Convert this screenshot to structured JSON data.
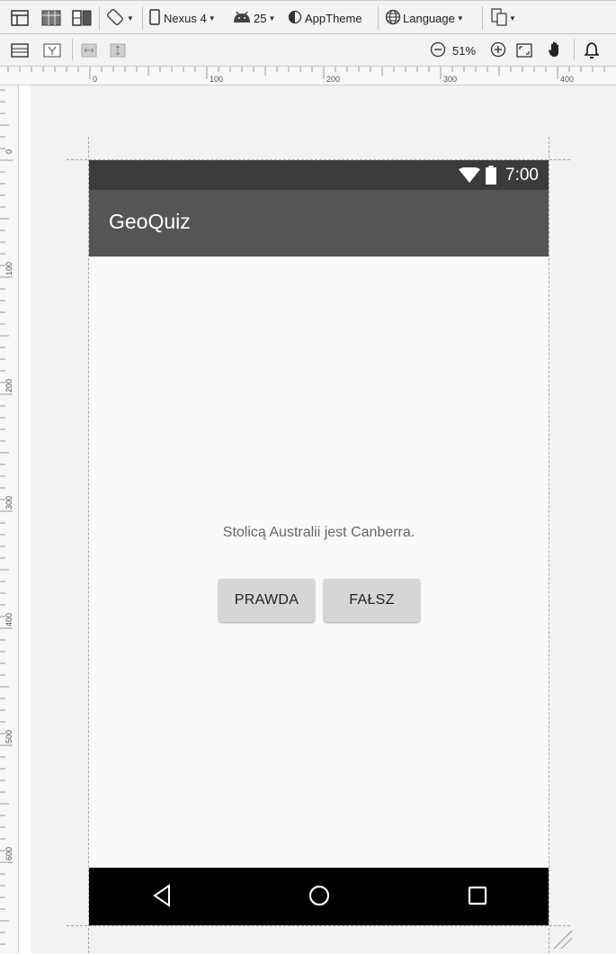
{
  "toolbar1": {
    "device": "Nexus 4",
    "api_level": "25",
    "theme": "AppTheme",
    "language": "Language"
  },
  "toolbar2": {
    "zoom": "51%"
  },
  "ruler": {
    "top_labels": [
      "0",
      "100",
      "200",
      "300",
      "400"
    ],
    "left_labels": [
      "0",
      "100",
      "200",
      "300",
      "400",
      "500",
      "600"
    ]
  },
  "device": {
    "status_time": "7:00",
    "app_title": "GeoQuiz",
    "question": "Stolicą Australii jest Canberra.",
    "true_button": "PRAWDA",
    "false_button": "FAŁSZ",
    "colors": {
      "status_bar": "#3b3b3b",
      "app_bar": "#555555",
      "nav_bar": "#000000",
      "button": "#d6d6d6"
    }
  }
}
